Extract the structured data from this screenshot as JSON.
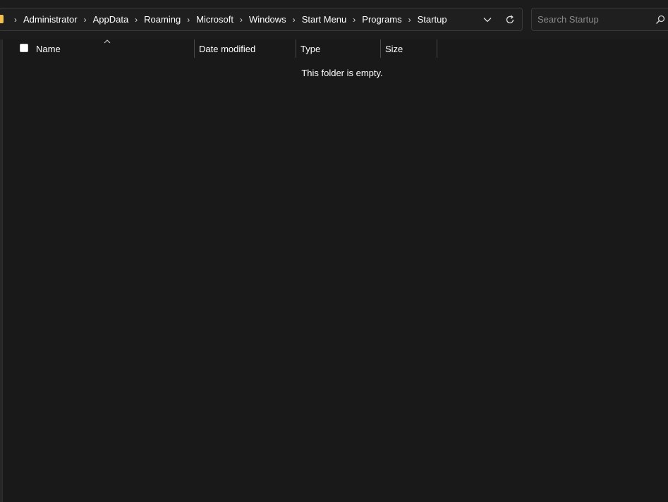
{
  "breadcrumb": {
    "items": [
      "Administrator",
      "AppData",
      "Roaming",
      "Microsoft",
      "Windows",
      "Start Menu",
      "Programs",
      "Startup"
    ],
    "separator": "›"
  },
  "search": {
    "placeholder": "Search Startup"
  },
  "columns": {
    "name": "Name",
    "date_modified": "Date modified",
    "type": "Type",
    "size": "Size"
  },
  "empty_message": "This folder is empty.",
  "colors": {
    "background": "#191919",
    "folder": "#f2c14b",
    "border": "#3a3a3a",
    "placeholder": "#8a8a8a"
  },
  "icons": {
    "folder": "folder-icon",
    "dropdown": "chevron-down-icon",
    "refresh": "refresh-icon",
    "search": "search-icon",
    "sort": "sort-ascending-icon"
  }
}
